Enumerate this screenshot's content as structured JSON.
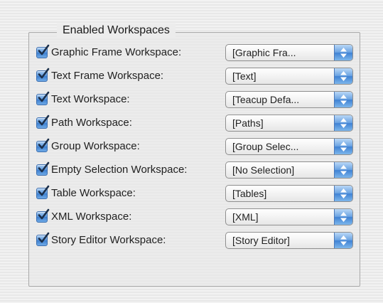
{
  "panel": {
    "title": "Enabled Workspaces",
    "rows": [
      {
        "label": "Graphic Frame Workspace:",
        "value": "[Graphic Fra...",
        "checked": true
      },
      {
        "label": "Text Frame Workspace:",
        "value": "[Text]",
        "checked": true
      },
      {
        "label": "Text Workspace:",
        "value": "[Teacup Defa...",
        "checked": true
      },
      {
        "label": "Path Workspace:",
        "value": "[Paths]",
        "checked": true
      },
      {
        "label": "Group Workspace:",
        "value": "[Group Selec...",
        "checked": true
      },
      {
        "label": "Empty Selection Workspace:",
        "value": "[No Selection]",
        "checked": true
      },
      {
        "label": "Table Workspace:",
        "value": "[Tables]",
        "checked": true
      },
      {
        "label": "XML Workspace:",
        "value": "[XML]",
        "checked": true
      },
      {
        "label": "Story Editor Workspace:",
        "value": "[Story Editor]",
        "checked": true
      }
    ]
  },
  "icons": {
    "checkbox": "checkmark-icon",
    "popup": "up-down-arrows-icon"
  },
  "colors": {
    "accent": "#5b97dc",
    "text": "#1f1f1f",
    "border": "#a9a9a9"
  }
}
